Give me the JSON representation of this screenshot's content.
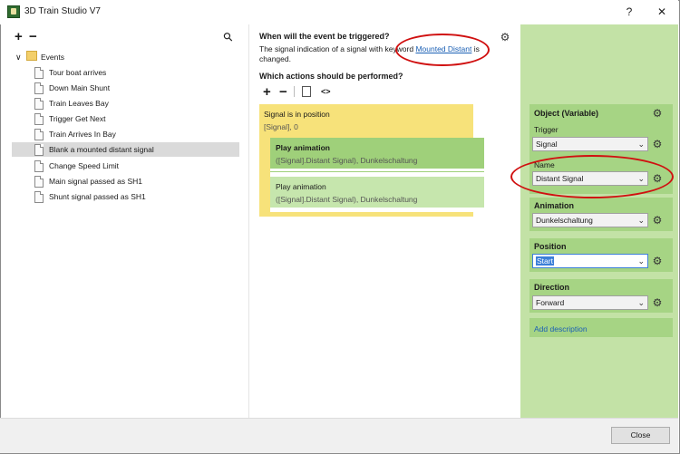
{
  "window": {
    "title": "3D Train Studio V7",
    "help_label": "?",
    "close_label": "✕"
  },
  "icons": {
    "plus": "+",
    "minus": "−",
    "search": "⚲",
    "gear": "⚙",
    "chevron_down": "⌄",
    "expand": "∨",
    "code": "<>"
  },
  "events": {
    "folder_label": "Events",
    "items": [
      "Tour boat arrives",
      "Down Main Shunt",
      "Train Leaves Bay",
      "Trigger Get Next",
      "Train Arrives In Bay",
      "Blank a mounted distant signal",
      "Change Speed Limit",
      "Main signal passed as SH1",
      "Shunt signal passed as SH1"
    ],
    "selected_index": 5
  },
  "trigger": {
    "heading": "When will the event be triggered?",
    "text_before": "The signal indication of a signal with keyword ",
    "link": "Mounted Distant",
    "text_after": " is",
    "text_line2": "changed."
  },
  "actions": {
    "heading": "Which actions should be performed?",
    "condition_title": "Signal is in position",
    "condition_sub": "[Signal], 0",
    "action1_title": "Play animation",
    "action1_sub": "([Signal].Distant Signal), Dunkelschaltung",
    "action2_title": "Play animation",
    "action2_sub": "([Signal].Distant Signal), Dunkelschaltung"
  },
  "properties": {
    "object_heading": "Object (Variable)",
    "trigger_label": "Trigger",
    "trigger_value": "Signal",
    "name_label": "Name",
    "name_value": "Distant Signal",
    "animation_heading": "Animation",
    "animation_value": "Dunkelschaltung",
    "position_heading": "Position",
    "position_value": "Start",
    "direction_heading": "Direction",
    "direction_value": "Forward",
    "add_description": "Add description"
  },
  "footer": {
    "close_button": "Close"
  },
  "colors": {
    "panel_green": "#c3e2a6",
    "box_green": "#a6d484",
    "condition_yellow": "#f7e27a",
    "action_green_dark": "#9fd07a",
    "action_green_light": "#c6e6ad",
    "annotation_red": "#d01010"
  }
}
